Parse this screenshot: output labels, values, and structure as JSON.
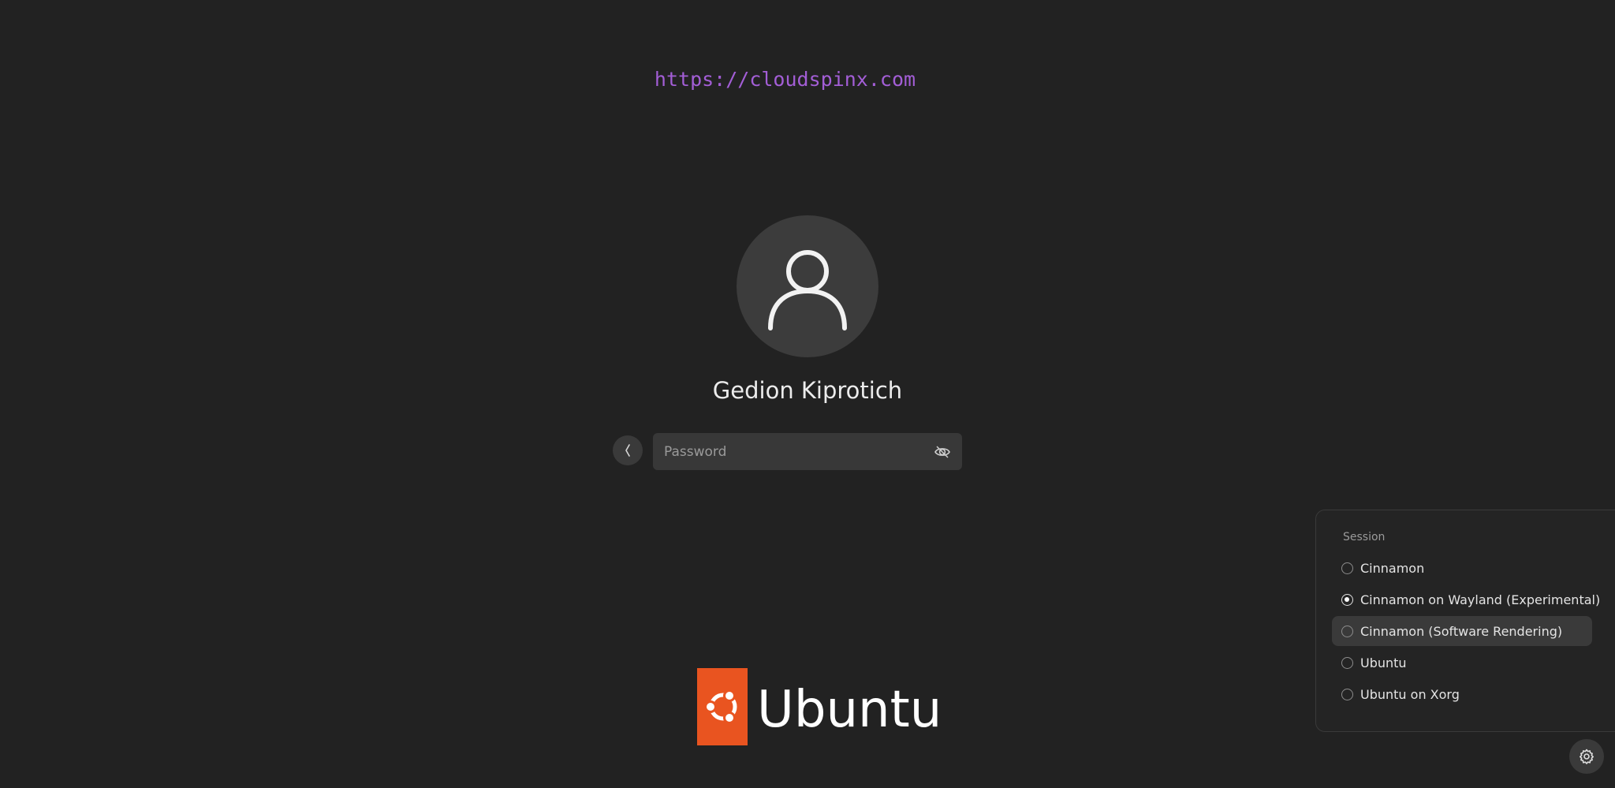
{
  "watermark": {
    "text": "https://cloudspinx.com"
  },
  "user": {
    "name": "Gedion Kiprotich",
    "avatar_icon": "user-silhouette-icon"
  },
  "password": {
    "placeholder": "Password",
    "value": ""
  },
  "icons": {
    "back": "chevron-left-icon",
    "reveal": "eye-icon",
    "settings": "gear-icon",
    "logo": "circle-of-friends-icon"
  },
  "brand": {
    "text": "Ubuntu",
    "color": "#e95420"
  },
  "session_menu": {
    "title": "Session",
    "items": [
      {
        "label": "Cinnamon",
        "selected": false,
        "highlighted": false
      },
      {
        "label": "Cinnamon on Wayland (Experimental)",
        "selected": true,
        "highlighted": false
      },
      {
        "label": "Cinnamon (Software Rendering)",
        "selected": false,
        "highlighted": true
      },
      {
        "label": "Ubuntu",
        "selected": false,
        "highlighted": false
      },
      {
        "label": "Ubuntu on Xorg",
        "selected": false,
        "highlighted": false
      }
    ]
  },
  "colors": {
    "background": "#222222",
    "watermark": "#a35ed6",
    "field": "#383838",
    "avatar_bg": "#3c3c3c"
  }
}
